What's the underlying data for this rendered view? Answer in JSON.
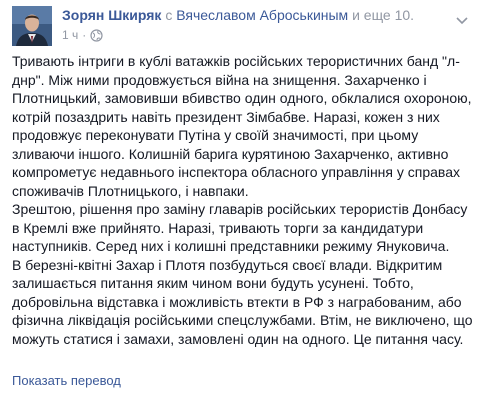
{
  "post": {
    "author": "Зорян Шкиряк",
    "with_prefix": "с",
    "tagged_person": "Вячеславом Аброськиным",
    "tagged_suffix": "и еще 10.",
    "timestamp": "1 ч",
    "separator": "·",
    "audience_icon": "globe-icon",
    "menu_icon": "chevron-down-icon",
    "paragraphs": [
      "Тривають інтриги в кублі ватажків російських терористичних банд \"л-днр\". Між ними продовжується війна на знищення. Захарченко і Плотницький, замовивши вбивство один одного, обклалися охороною, котрій позаздрить навіть президент Зімбабве. Наразі, кожен з них продовжує переконувати Путіна у своїй значимості, при цьому зливаючи іншого. Колишній барига курятиною Захарченко, активно компрометує недавнього інспектора обласного управління у справах споживачів Плотницького, і навпаки.",
      "Зрештою, рішення про заміну главарів російських терористів Донбасу в Кремлі вже прийнято. Наразі, тривають торги за кандидатури наступників. Серед них і колишні представники режиму Януковича.",
      "В березні-квітні Захар і Плотя позбудуться своєї влади. Відкритим залишається питання яким чином вони будуть усунені. Тобто, добровільна відставка і можливість втекти в РФ з награбованим, або фізична ліквідація російськими спецслужбами. Втім, не виключено, що можуть статися і замахи, замовлені один на одного. Це питання часу."
    ],
    "see_translation": "Показать перевод"
  },
  "colors": {
    "link": "#3b5998",
    "meta": "#9197a3",
    "text": "#141823"
  }
}
